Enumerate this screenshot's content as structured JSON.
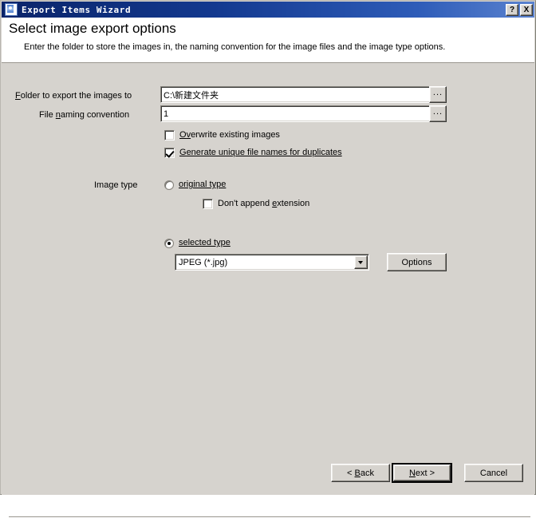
{
  "window": {
    "title": "Export Items Wizard",
    "icon": "wizard-icon",
    "help_button": "?",
    "close_button": "X"
  },
  "header": {
    "title": "Select image export options",
    "subtitle": "Enter the folder to store the images in, the naming convention for the image files and the image type options."
  },
  "form": {
    "folder_label_pre": "F",
    "folder_label_post": "older to export the images to",
    "folder_value": "C:\\新建文件夹",
    "folder_browse_label": "...",
    "naming_label_pre": "File ",
    "naming_label_mid": "n",
    "naming_label_post": "aming convention",
    "naming_value": "1",
    "naming_browse_label": "...",
    "overwrite_pre": "O",
    "overwrite_mid": "v",
    "overwrite_post": "erwrite existing images",
    "overwrite_checked": false,
    "generate_pre": "G",
    "generate_post": "enerate unique file names for duplicates",
    "generate_checked": true
  },
  "image_type": {
    "section_label_pre": "Ima",
    "section_label_mid": "g",
    "section_label_post": "e type",
    "original_pre": "o",
    "original_post": "riginal type",
    "original_selected": false,
    "no_extension_pre": "Don't append ",
    "no_extension_mid": "e",
    "no_extension_post": "xtension",
    "no_extension_checked": false,
    "selected_pre": "s",
    "selected_post": "elected type",
    "selected_selected": true,
    "format_value": "JPEG (*.jpg)",
    "options_button": "Options"
  },
  "footer": {
    "back_pre": "< ",
    "back_mid": "B",
    "back_post": "ack",
    "next_pre": "",
    "next_mid": "N",
    "next_post": "ext >",
    "cancel_label": "Cancel"
  },
  "colors": {
    "title_bar_start": "#0a246a",
    "title_bar_end": "#5a82cf",
    "dialog_face": "#d6d3ce",
    "header_background": "#ffffff",
    "field_background": "#ffffff"
  }
}
